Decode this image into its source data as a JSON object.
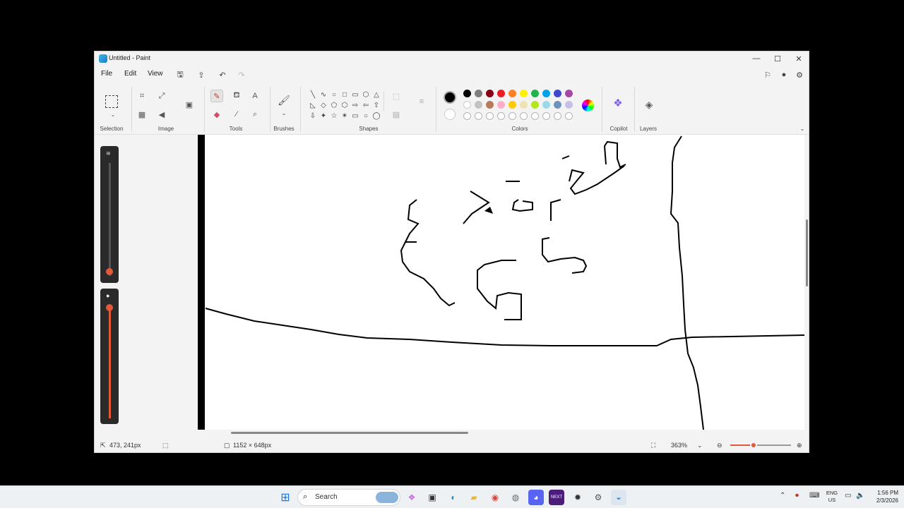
{
  "window": {
    "title": "Untitled - Paint",
    "minimize_icon": "minimize-icon",
    "maximize_icon": "maximize-icon",
    "close_icon": "close-icon"
  },
  "menu": {
    "file": "File",
    "edit": "Edit",
    "view": "View"
  },
  "ribbon": {
    "groups": {
      "selection": "Selection",
      "image": "Image",
      "tools": "Tools",
      "brushes": "Brushes",
      "shapes": "Shapes",
      "colors": "Colors",
      "copilot": "Copilot",
      "layers": "Layers"
    },
    "shapes": [
      "╲",
      "∿",
      "○",
      "□",
      "▭",
      "⬡",
      "△",
      "◺",
      "◇",
      "⬠",
      "⬡",
      "⇨",
      "⇦",
      "⇧",
      "⇩",
      "✦",
      "☆",
      "✶",
      "▭",
      "○",
      "◯"
    ],
    "primary_color": "#000000",
    "secondary_color": "#ffffff",
    "palette_row1": [
      "#000000",
      "#7f7f7f",
      "#880015",
      "#ed1c24",
      "#ff7f27",
      "#fff200",
      "#22b14c",
      "#00a2e8",
      "#3f48cc",
      "#a349a4"
    ],
    "palette_row2": [
      "#ffffff",
      "#c3c3c3",
      "#b97a57",
      "#ffaec9",
      "#ffc90e",
      "#efe4b0",
      "#b5e61d",
      "#99d9ea",
      "#7092be",
      "#c8bfe7"
    ]
  },
  "status": {
    "cursor_position": "473, 241px",
    "canvas_size": "1152 × 648px",
    "zoom": "363%",
    "zoom_level": 0.38
  },
  "taskbar": {
    "search": "Search",
    "language_top": "ENG",
    "language_bottom": "US",
    "time": "1:56 PM",
    "date": "2/3/2026"
  }
}
